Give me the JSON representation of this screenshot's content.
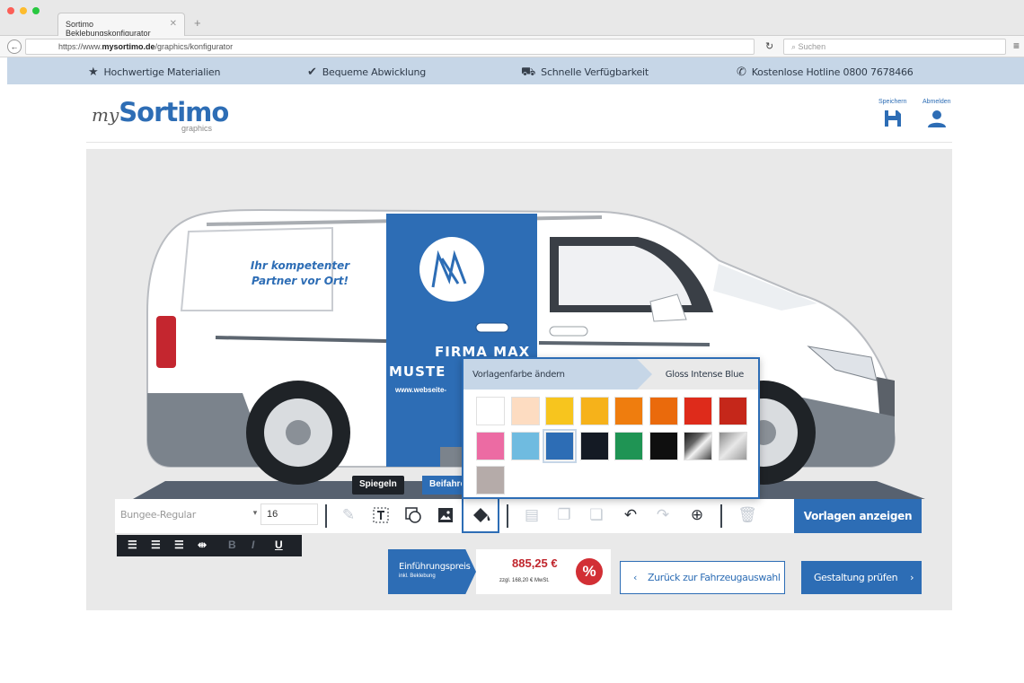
{
  "browser": {
    "tab_title": "Sortimo Beklebungskonfigurator",
    "url_prefix": "https://www.",
    "url_domain": "mysortimo.de",
    "url_path": "/graphics/konfigurator",
    "search_placeholder": "Suchen"
  },
  "infobar": {
    "items": [
      {
        "icon": "star-icon",
        "label": "Hochwertige Materialien"
      },
      {
        "icon": "checkmark-icon",
        "label": "Bequeme Abwicklung"
      },
      {
        "icon": "truck-icon",
        "label": "Schnelle Verfügbarkeit"
      },
      {
        "icon": "phone-icon",
        "label": "Kostenlose Hotline 0800 7678466"
      }
    ]
  },
  "header": {
    "logo_my": "my",
    "logo_brand": "Sortimo",
    "logo_sub": "graphics",
    "save_label": "Speichern",
    "logout_label": "Abmelden"
  },
  "van": {
    "slogan": "Ihr kompetenter Partner vor Ort!",
    "company_line1": "FIRMA MAX",
    "company_line2": "MUSTE",
    "website": "www.webseite-",
    "mirror_button": "Spiegeln",
    "side_button": "Beifahrer"
  },
  "color_popup": {
    "title": "Vorlagenfarbe ändern",
    "current_color": "Gloss Intense Blue",
    "swatches": [
      "#ffffff",
      "#fddcc1",
      "#f7c51e",
      "#f6b21a",
      "#ef7d0e",
      "#ea6a0c",
      "#de2b1b",
      "#c5271a",
      "#ec6ba3",
      "#6fbbe0",
      "#2d6db5",
      "#141a24",
      "#1f9454",
      "#0f0f0f",
      "chrome",
      "silver",
      "#b5aba9"
    ],
    "selected_index": 10
  },
  "toolbar": {
    "font_name": "Bungee-Regular",
    "font_size": "16",
    "templates_button": "Vorlagen anzeigen"
  },
  "price": {
    "label": "Einführungspreis",
    "sublabel": "inkl. Beklebung",
    "value": "885,25 €",
    "vat": "zzgl. 168,20 € MwSt.",
    "badge": "%"
  },
  "nav": {
    "back_label": "Zurück zur Fahrzeugauswahl",
    "back_icon": "chevron-left-icon",
    "next_label": "Gestaltung prüfen",
    "next_icon": "chevron-right-icon"
  },
  "colors": {
    "brand_blue": "#2d6db5",
    "infobar": "#c6d6e7",
    "price_red": "#c0262d"
  }
}
